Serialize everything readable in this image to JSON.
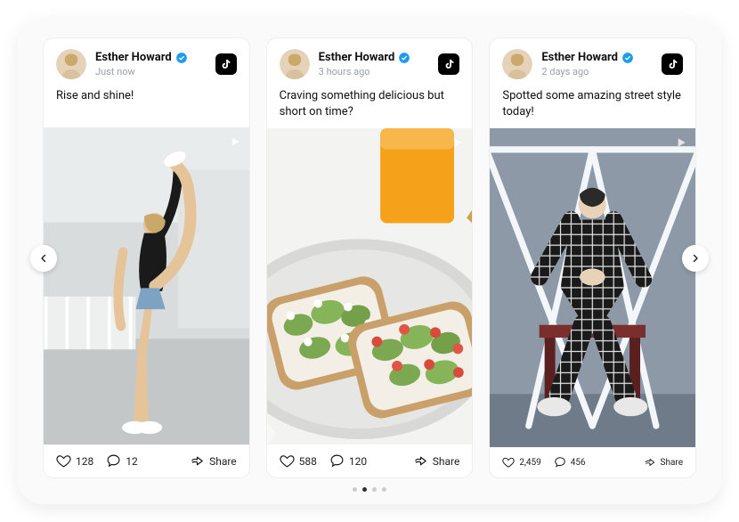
{
  "author": {
    "name": "Esther Howard"
  },
  "posts": [
    {
      "timestamp": "Just now",
      "caption": "Rise and shine!",
      "likes": "128",
      "comments": "12",
      "share_label": "Share"
    },
    {
      "timestamp": "3 hours ago",
      "caption": "Craving something delicious but short on time?",
      "likes": "588",
      "comments": "120",
      "share_label": "Share"
    },
    {
      "timestamp": "2 days ago",
      "caption": "Spotted some amazing street style today!",
      "likes": "2,459",
      "comments": "456",
      "share_label": "Share"
    }
  ],
  "pagination": {
    "total": 4,
    "active_index": 1
  }
}
